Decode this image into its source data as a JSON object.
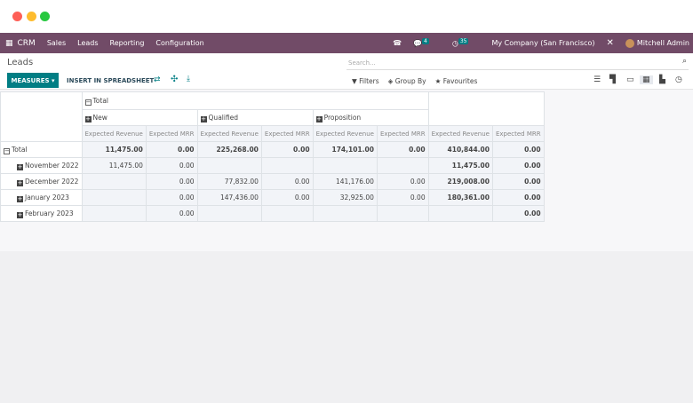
{
  "navbar": {
    "app": "CRM",
    "menus": [
      "Sales",
      "Leads",
      "Reporting",
      "Configuration"
    ],
    "messages_count": "4",
    "activities_count": "35",
    "company": "My Company (San Francisco)",
    "user": "Mitchell Admin",
    "color": "#714b67"
  },
  "control": {
    "title": "Leads",
    "measures": "MEASURES",
    "insert": "INSERT IN SPREADSHEET",
    "search_placeholder": "Search...",
    "filters": "Filters",
    "group_by": "Group By",
    "favourites": "Favourites",
    "accent": "#017e84"
  },
  "pivot": {
    "col_total": "Total",
    "groups": [
      "New",
      "Qualified",
      "Proposition"
    ],
    "measures": [
      "Expected Revenue",
      "Expected MRR"
    ],
    "row_total": "Total",
    "rows": [
      {
        "label": "Total",
        "cells": [
          "11,475.00",
          "0.00",
          "225,268.00",
          "0.00",
          "174,101.00",
          "0.00",
          "410,844.00",
          "0.00"
        ]
      },
      {
        "label": "November 2022",
        "cells": [
          "11,475.00",
          "0.00",
          "",
          "",
          "",
          "",
          "11,475.00",
          "0.00"
        ]
      },
      {
        "label": "December 2022",
        "cells": [
          "",
          "0.00",
          "77,832.00",
          "0.00",
          "141,176.00",
          "0.00",
          "219,008.00",
          "0.00"
        ]
      },
      {
        "label": "January 2023",
        "cells": [
          "",
          "0.00",
          "147,436.00",
          "0.00",
          "32,925.00",
          "0.00",
          "180,361.00",
          "0.00"
        ]
      },
      {
        "label": "February 2023",
        "cells": [
          "",
          "0.00",
          "",
          "",
          "",
          "",
          "",
          "0.00"
        ]
      }
    ]
  }
}
